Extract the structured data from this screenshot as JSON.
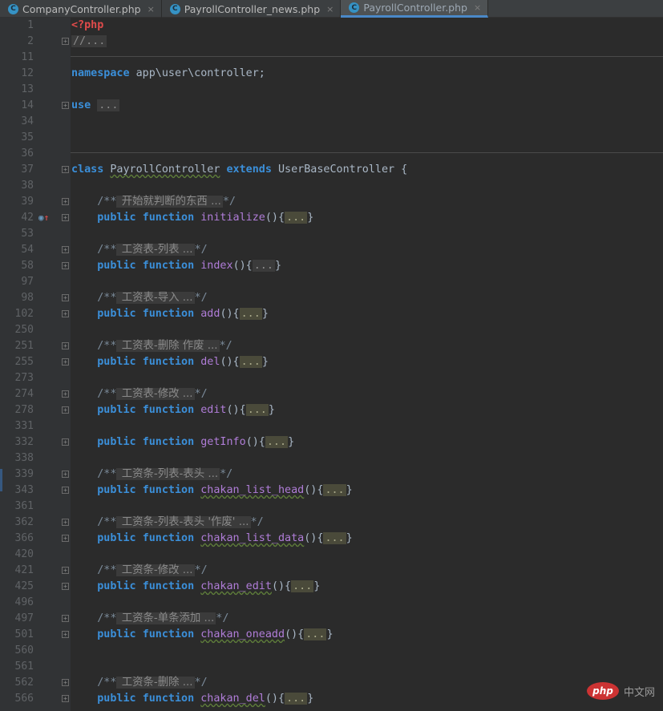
{
  "tabs": [
    {
      "label": "CompanyController.php",
      "close": "×"
    },
    {
      "label": "PayrollController_news.php",
      "close": "×"
    },
    {
      "label": "PayrollController.php",
      "close": "×"
    }
  ],
  "tab_icon_letter": "C",
  "watermark": {
    "logo": "php",
    "text": "中文网"
  },
  "colors": {
    "keyword": "#3b8fd9",
    "function_name": "#b07dd8",
    "comment": "#7a8a99",
    "php_tag": "#e04b4b",
    "background": "#2b2b2b"
  },
  "editor": {
    "lines": [
      {
        "n": "1",
        "parts": [
          {
            "t": "<?php",
            "c": "php"
          }
        ]
      },
      {
        "n": "2",
        "fold": true,
        "parts": [
          {
            "t": "//...",
            "c": "folded"
          }
        ]
      },
      {
        "n": "11",
        "sep": true,
        "parts": []
      },
      {
        "n": "12",
        "parts": [
          {
            "t": "namespace",
            "c": "kw"
          },
          {
            "t": " app\\user\\controller;"
          }
        ]
      },
      {
        "n": "13",
        "parts": []
      },
      {
        "n": "14",
        "fold": true,
        "parts": [
          {
            "t": "use",
            "c": "kw"
          },
          {
            "t": " "
          },
          {
            "t": "...",
            "c": "folded"
          }
        ]
      },
      {
        "n": "34",
        "parts": []
      },
      {
        "n": "35",
        "parts": []
      },
      {
        "n": "36",
        "sep": true,
        "parts": []
      },
      {
        "n": "37",
        "fold": true,
        "parts": [
          {
            "t": "class",
            "c": "kw"
          },
          {
            "t": " "
          },
          {
            "t": "PayrollController",
            "c": "squig"
          },
          {
            "t": " "
          },
          {
            "t": "extends",
            "c": "kw"
          },
          {
            "t": " UserBaseController {"
          }
        ]
      },
      {
        "n": "38",
        "parts": []
      },
      {
        "n": "39",
        "fold": true,
        "parts": [
          {
            "t": "    "
          },
          {
            "t": "/**",
            "c": "cm"
          },
          {
            "t": " 开始就判断的东西 ...",
            "c": "folded cjk"
          },
          {
            "t": "*/",
            "c": "cm"
          }
        ]
      },
      {
        "n": "42",
        "fold": true,
        "override": true,
        "parts": [
          {
            "t": "    "
          },
          {
            "t": "public",
            "c": "kw"
          },
          {
            "t": " "
          },
          {
            "t": "function",
            "c": "kw"
          },
          {
            "t": " "
          },
          {
            "t": "initialize",
            "c": "fn"
          },
          {
            "t": "(){"
          },
          {
            "t": "...",
            "c": "folded-ann"
          },
          {
            "t": "}"
          }
        ]
      },
      {
        "n": "53",
        "parts": []
      },
      {
        "n": "54",
        "fold": true,
        "parts": [
          {
            "t": "    "
          },
          {
            "t": "/**",
            "c": "cm"
          },
          {
            "t": " 工资表-列表 ...",
            "c": "folded cjk"
          },
          {
            "t": "*/",
            "c": "cm"
          }
        ]
      },
      {
        "n": "58",
        "fold": true,
        "parts": [
          {
            "t": "    "
          },
          {
            "t": "public",
            "c": "kw"
          },
          {
            "t": " "
          },
          {
            "t": "function",
            "c": "kw"
          },
          {
            "t": " "
          },
          {
            "t": "index",
            "c": "fn"
          },
          {
            "t": "(){"
          },
          {
            "t": "...",
            "c": "folded"
          },
          {
            "t": "}"
          }
        ]
      },
      {
        "n": "97",
        "parts": []
      },
      {
        "n": "98",
        "fold": true,
        "parts": [
          {
            "t": "    "
          },
          {
            "t": "/**",
            "c": "cm"
          },
          {
            "t": " 工资表-导入 ...",
            "c": "folded cjk"
          },
          {
            "t": "*/",
            "c": "cm"
          }
        ]
      },
      {
        "n": "102",
        "fold": true,
        "parts": [
          {
            "t": "    "
          },
          {
            "t": "public",
            "c": "kw"
          },
          {
            "t": " "
          },
          {
            "t": "function",
            "c": "kw"
          },
          {
            "t": " "
          },
          {
            "t": "add",
            "c": "fn"
          },
          {
            "t": "(){"
          },
          {
            "t": "...",
            "c": "folded-ann"
          },
          {
            "t": "}"
          }
        ]
      },
      {
        "n": "250",
        "parts": []
      },
      {
        "n": "251",
        "fold": true,
        "parts": [
          {
            "t": "    "
          },
          {
            "t": "/**",
            "c": "cm"
          },
          {
            "t": " 工资表-删除 作废 ...",
            "c": "folded cjk"
          },
          {
            "t": "*/",
            "c": "cm"
          }
        ]
      },
      {
        "n": "255",
        "fold": true,
        "parts": [
          {
            "t": "    "
          },
          {
            "t": "public",
            "c": "kw"
          },
          {
            "t": " "
          },
          {
            "t": "function",
            "c": "kw"
          },
          {
            "t": " "
          },
          {
            "t": "del",
            "c": "fn"
          },
          {
            "t": "(){"
          },
          {
            "t": "...",
            "c": "folded-ann"
          },
          {
            "t": "}"
          }
        ]
      },
      {
        "n": "273",
        "parts": []
      },
      {
        "n": "274",
        "fold": true,
        "parts": [
          {
            "t": "    "
          },
          {
            "t": "/**",
            "c": "cm"
          },
          {
            "t": " 工资表-修改 ...",
            "c": "folded cjk"
          },
          {
            "t": "*/",
            "c": "cm"
          }
        ]
      },
      {
        "n": "278",
        "fold": true,
        "parts": [
          {
            "t": "    "
          },
          {
            "t": "public",
            "c": "kw"
          },
          {
            "t": " "
          },
          {
            "t": "function",
            "c": "kw"
          },
          {
            "t": " "
          },
          {
            "t": "edit",
            "c": "fn"
          },
          {
            "t": "(){"
          },
          {
            "t": "...",
            "c": "folded-ann"
          },
          {
            "t": "}"
          }
        ]
      },
      {
        "n": "331",
        "parts": []
      },
      {
        "n": "332",
        "fold": true,
        "parts": [
          {
            "t": "    "
          },
          {
            "t": "public",
            "c": "kw"
          },
          {
            "t": " "
          },
          {
            "t": "function",
            "c": "kw"
          },
          {
            "t": " "
          },
          {
            "t": "getInfo",
            "c": "fn"
          },
          {
            "t": "(){"
          },
          {
            "t": "...",
            "c": "folded-ann"
          },
          {
            "t": "}"
          }
        ]
      },
      {
        "n": "338",
        "parts": []
      },
      {
        "n": "339",
        "fold": true,
        "parts": [
          {
            "t": "    "
          },
          {
            "t": "/**",
            "c": "cm"
          },
          {
            "t": " 工资条-列表-表头 ...",
            "c": "folded cjk"
          },
          {
            "t": "*/",
            "c": "cm"
          }
        ]
      },
      {
        "n": "343",
        "fold": true,
        "parts": [
          {
            "t": "    "
          },
          {
            "t": "public",
            "c": "kw"
          },
          {
            "t": " "
          },
          {
            "t": "function",
            "c": "kw"
          },
          {
            "t": " "
          },
          {
            "t": "chakan_list_head",
            "c": "fn squig"
          },
          {
            "t": "(){"
          },
          {
            "t": "...",
            "c": "folded-ann"
          },
          {
            "t": "}"
          }
        ]
      },
      {
        "n": "361",
        "parts": []
      },
      {
        "n": "362",
        "fold": true,
        "parts": [
          {
            "t": "    "
          },
          {
            "t": "/**",
            "c": "cm"
          },
          {
            "t": " 工资条-列表-表头 '作废' ...",
            "c": "folded cjk"
          },
          {
            "t": "*/",
            "c": "cm"
          }
        ]
      },
      {
        "n": "366",
        "fold": true,
        "parts": [
          {
            "t": "    "
          },
          {
            "t": "public",
            "c": "kw"
          },
          {
            "t": " "
          },
          {
            "t": "function",
            "c": "kw"
          },
          {
            "t": " "
          },
          {
            "t": "chakan_list_data",
            "c": "fn squig"
          },
          {
            "t": "(){"
          },
          {
            "t": "...",
            "c": "folded-ann"
          },
          {
            "t": "}"
          }
        ]
      },
      {
        "n": "420",
        "parts": []
      },
      {
        "n": "421",
        "fold": true,
        "parts": [
          {
            "t": "    "
          },
          {
            "t": "/**",
            "c": "cm"
          },
          {
            "t": " 工资条-修改 ...",
            "c": "folded cjk"
          },
          {
            "t": "*/",
            "c": "cm"
          }
        ]
      },
      {
        "n": "425",
        "fold": true,
        "parts": [
          {
            "t": "    "
          },
          {
            "t": "public",
            "c": "kw"
          },
          {
            "t": " "
          },
          {
            "t": "function",
            "c": "kw"
          },
          {
            "t": " "
          },
          {
            "t": "chakan_edit",
            "c": "fn squig"
          },
          {
            "t": "(){"
          },
          {
            "t": "...",
            "c": "folded-ann"
          },
          {
            "t": "}"
          }
        ]
      },
      {
        "n": "496",
        "parts": []
      },
      {
        "n": "497",
        "fold": true,
        "parts": [
          {
            "t": "    "
          },
          {
            "t": "/**",
            "c": "cm"
          },
          {
            "t": " 工资条-单条添加 ...",
            "c": "folded cjk"
          },
          {
            "t": "*/",
            "c": "cm"
          }
        ]
      },
      {
        "n": "501",
        "fold": true,
        "parts": [
          {
            "t": "    "
          },
          {
            "t": "public",
            "c": "kw"
          },
          {
            "t": " "
          },
          {
            "t": "function",
            "c": "kw"
          },
          {
            "t": " "
          },
          {
            "t": "chakan_oneadd",
            "c": "fn squig"
          },
          {
            "t": "(){"
          },
          {
            "t": "...",
            "c": "folded-ann"
          },
          {
            "t": "}"
          }
        ]
      },
      {
        "n": "560",
        "parts": []
      },
      {
        "n": "561",
        "parts": []
      },
      {
        "n": "562",
        "fold": true,
        "parts": [
          {
            "t": "    "
          },
          {
            "t": "/**",
            "c": "cm"
          },
          {
            "t": " 工资条-删除 ...",
            "c": "folded cjk"
          },
          {
            "t": "*/",
            "c": "cm"
          }
        ]
      },
      {
        "n": "566",
        "fold": true,
        "parts": [
          {
            "t": "    "
          },
          {
            "t": "public",
            "c": "kw"
          },
          {
            "t": " "
          },
          {
            "t": "function",
            "c": "kw"
          },
          {
            "t": " "
          },
          {
            "t": "chakan_del",
            "c": "fn squig"
          },
          {
            "t": "(){"
          },
          {
            "t": "...",
            "c": "folded-ann"
          },
          {
            "t": "}"
          }
        ]
      }
    ]
  }
}
